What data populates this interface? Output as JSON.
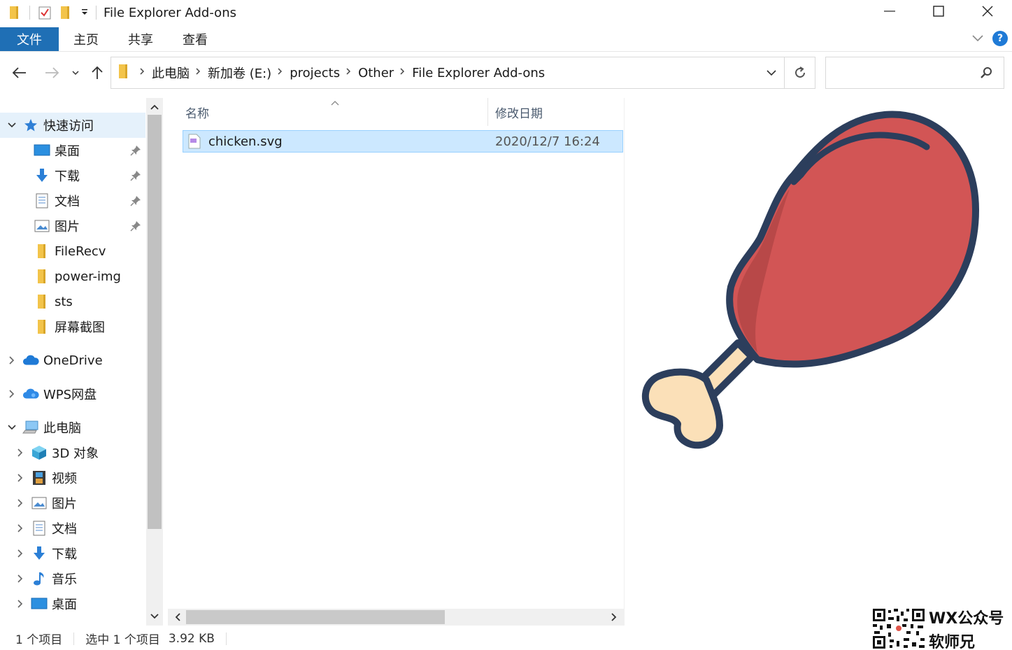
{
  "window": {
    "title": "File Explorer Add-ons"
  },
  "ribbon": {
    "tabs": [
      "文件",
      "主页",
      "共享",
      "查看"
    ],
    "help_label": "?"
  },
  "address": {
    "crumbs": [
      "此电脑",
      "新加卷 (E:)",
      "projects",
      "Other",
      "File Explorer Add-ons"
    ]
  },
  "search": {
    "placeholder": ""
  },
  "sidebar": {
    "quick_access": "快速访问",
    "quick_items": [
      "桌面",
      "下载",
      "文档",
      "图片",
      "FileRecv",
      "power-img",
      "sts",
      "屏幕截图"
    ],
    "onedrive": "OneDrive",
    "wps": "WPS网盘",
    "this_pc": "此电脑",
    "pc_items": [
      "3D 对象",
      "视频",
      "图片",
      "文档",
      "下载",
      "音乐",
      "桌面"
    ]
  },
  "filelist": {
    "columns": {
      "name": "名称",
      "modified": "修改日期"
    },
    "rows": [
      {
        "name": "chicken.svg",
        "modified": "2020/12/7 16:24"
      }
    ]
  },
  "status": {
    "count": "1 个项目",
    "selected": "选中 1 个项目",
    "size": "3.92 KB"
  },
  "watermark": {
    "line1": "WX公众号",
    "line2": "软师兄"
  },
  "colors": {
    "accent": "#1f6fb5",
    "selection": "#cce8ff",
    "drumstick_meat": "#d25555",
    "drumstick_outline": "#2c3e5c",
    "bone": "#fbe0b8"
  }
}
